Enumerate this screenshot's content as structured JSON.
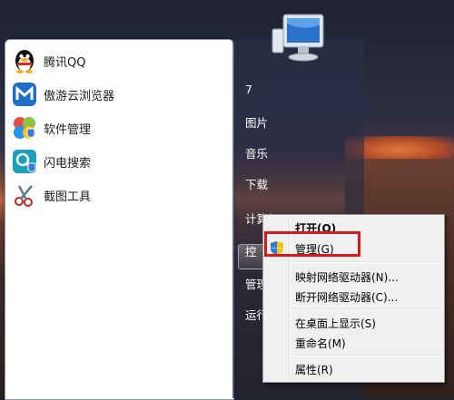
{
  "programs": [
    {
      "label": "腾讯QQ",
      "icon": "qq-penguin-icon"
    },
    {
      "label": "傲游云浏览器",
      "icon": "maxthon-browser-icon"
    },
    {
      "label": "软件管理",
      "icon": "software-manager-icon"
    },
    {
      "label": "闪电搜索",
      "icon": "lightning-search-icon"
    },
    {
      "label": "截图工具",
      "icon": "snipping-tool-icon"
    }
  ],
  "right_items": [
    {
      "label": "7"
    },
    {
      "label": "图片"
    },
    {
      "label": "音乐"
    },
    {
      "label": "下载"
    },
    {
      "label": "计算机"
    },
    {
      "label": "控"
    },
    {
      "label": "管理"
    },
    {
      "label": "运行"
    }
  ],
  "context_menu": {
    "open": "打开(O)",
    "manage": "管理(G)",
    "map_drive": "映射网络驱动器(N)...",
    "disconnect_drive": "断开网络驱动器(C)...",
    "show_desktop": "在桌面上显示(S)",
    "rename": "重命名(M)",
    "properties": "属性(R)"
  },
  "colors": {
    "highlight_box": "#d6191b"
  }
}
